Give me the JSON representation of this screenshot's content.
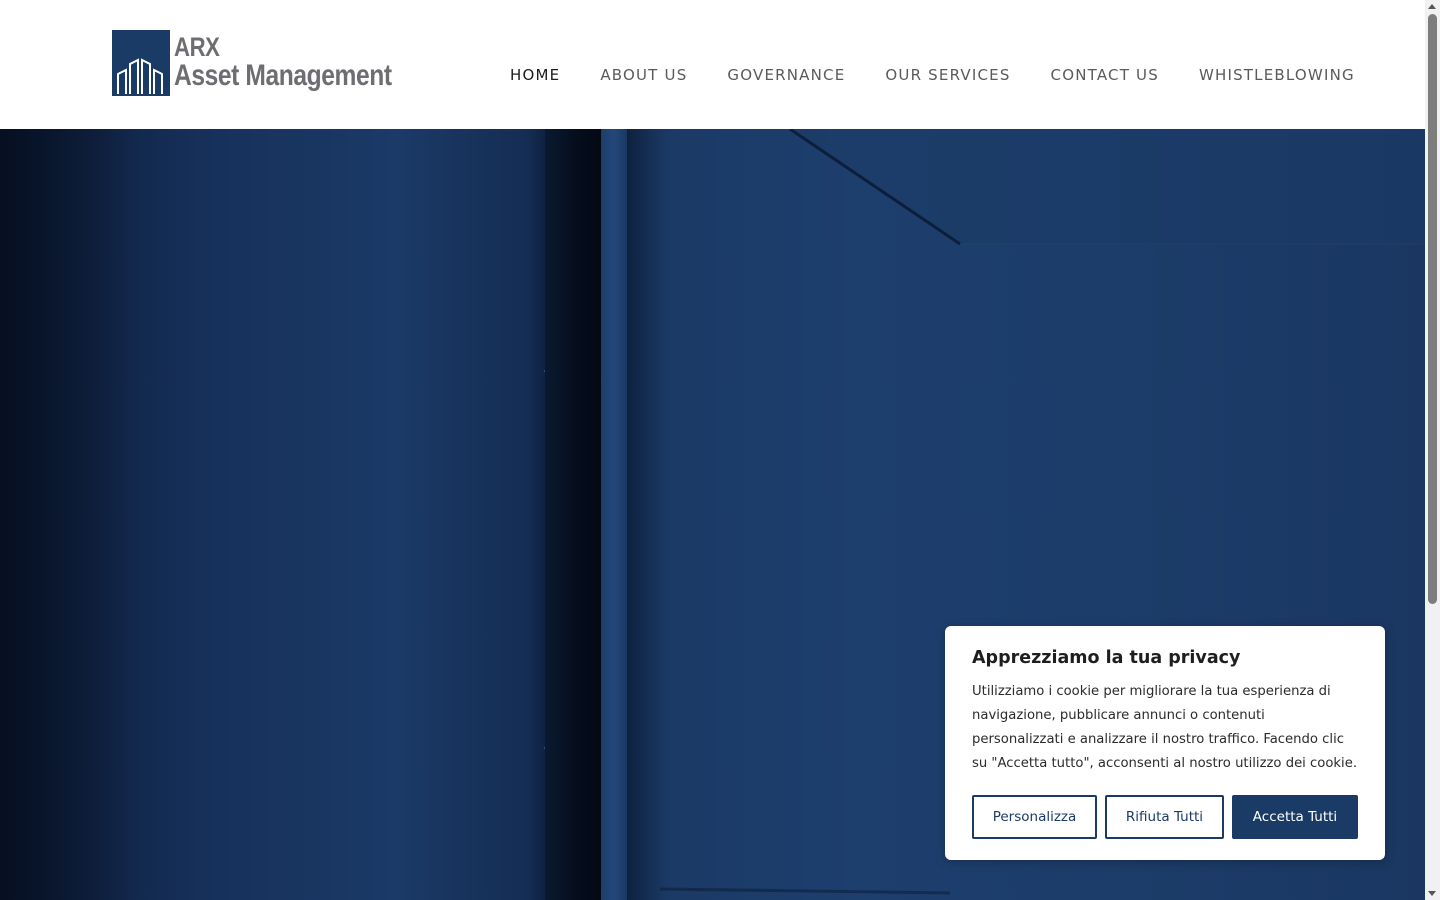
{
  "brand": {
    "line1": "ARX",
    "line2": "Asset Management",
    "color": "#1a3b66"
  },
  "nav": {
    "items": [
      {
        "label": "HOME",
        "active": true
      },
      {
        "label": "ABOUT US"
      },
      {
        "label": "GOVERNANCE"
      },
      {
        "label": "OUR SERVICES"
      },
      {
        "label": "CONTACT US"
      },
      {
        "label": "WHISTLEBLOWING"
      }
    ]
  },
  "cookie_banner": {
    "title": "Apprezziamo la tua privacy",
    "body": "Utilizziamo i cookie per migliorare la tua esperienza di navigazione, pubblicare annunci o contenuti personalizzati e analizzare il nostro traffico. Facendo clic su \"Accetta tutto\", acconsenti al nostro utilizzo dei cookie.",
    "buttons": {
      "customize": "Personalizza",
      "reject_all": "Rifiuta Tutti",
      "accept_all": "Accetta Tutti"
    }
  }
}
